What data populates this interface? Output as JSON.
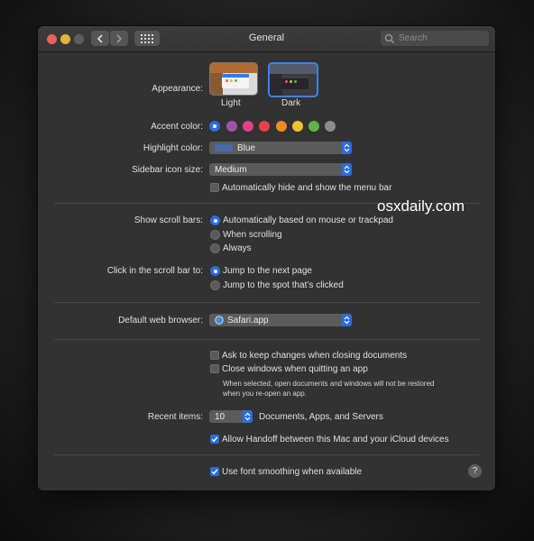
{
  "window": {
    "title": "General",
    "search_placeholder": "Search"
  },
  "appearance": {
    "label": "Appearance:",
    "options": [
      {
        "label": "Light",
        "selected": false
      },
      {
        "label": "Dark",
        "selected": true
      }
    ]
  },
  "accent": {
    "label": "Accent color:",
    "selected": "multicolor",
    "colors": [
      {
        "name": "multicolor",
        "hex": "#2b6de0"
      },
      {
        "name": "purple",
        "hex": "#a550a7"
      },
      {
        "name": "pink",
        "hex": "#e2418a"
      },
      {
        "name": "red",
        "hex": "#e8404b"
      },
      {
        "name": "orange",
        "hex": "#f28a25"
      },
      {
        "name": "yellow",
        "hex": "#f2c12e"
      },
      {
        "name": "green",
        "hex": "#5eb447"
      },
      {
        "name": "graphite",
        "hex": "#8c8c8c"
      }
    ]
  },
  "highlight": {
    "label": "Highlight color:",
    "value": "Blue",
    "swatch": "#4669a8"
  },
  "sidebar_icon": {
    "label": "Sidebar icon size:",
    "value": "Medium"
  },
  "menu_bar": {
    "label": "Automatically hide and show the menu bar",
    "checked": false
  },
  "scroll_bars": {
    "label": "Show scroll bars:",
    "options": [
      {
        "label": "Automatically based on mouse or trackpad",
        "selected": true
      },
      {
        "label": "When scrolling",
        "selected": false
      },
      {
        "label": "Always",
        "selected": false
      }
    ]
  },
  "scroll_click": {
    "label": "Click in the scroll bar to:",
    "options": [
      {
        "label": "Jump to the next page",
        "selected": true
      },
      {
        "label": "Jump to the spot that’s clicked",
        "selected": false
      }
    ]
  },
  "browser": {
    "label": "Default web browser:",
    "value": "Safari.app"
  },
  "documents": {
    "ask_label": "Ask to keep changes when closing documents",
    "ask_checked": false,
    "close_label": "Close windows when quitting an app",
    "close_checked": false,
    "note_line1": "When selected, open documents and windows will not be restored",
    "note_line2": "when you re-open an app."
  },
  "recent": {
    "label": "Recent items:",
    "value": "10",
    "suffix": "Documents, Apps, and Servers"
  },
  "handoff": {
    "label": "Allow Handoff between this Mac and your iCloud devices",
    "checked": true
  },
  "font_smoothing": {
    "label": "Use font smoothing when available",
    "checked": true
  },
  "help_glyph": "?",
  "watermark": "osxdaily.com"
}
